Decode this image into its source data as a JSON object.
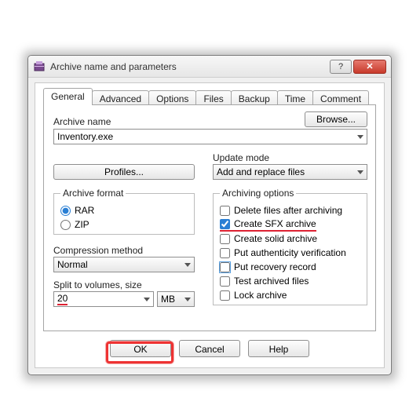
{
  "window": {
    "title": "Archive name and parameters"
  },
  "tabs": [
    "General",
    "Advanced",
    "Options",
    "Files",
    "Backup",
    "Time",
    "Comment"
  ],
  "archive_name": {
    "label": "Archive name",
    "value": "Inventory.exe",
    "browse": "Browse..."
  },
  "profiles_btn": "Profiles...",
  "update_mode": {
    "label": "Update mode",
    "value": "Add and replace files"
  },
  "archive_format": {
    "legend": "Archive format",
    "rar": "RAR",
    "zip": "ZIP"
  },
  "archiving_options": {
    "legend": "Archiving options",
    "items": [
      "Delete files after archiving",
      "Create SFX archive",
      "Create solid archive",
      "Put authenticity verification",
      "Put recovery record",
      "Test archived files",
      "Lock archive"
    ]
  },
  "compression": {
    "label": "Compression method",
    "value": "Normal"
  },
  "split": {
    "label": "Split to volumes, size",
    "value": "20",
    "unit": "MB"
  },
  "buttons": {
    "ok": "OK",
    "cancel": "Cancel",
    "help": "Help"
  }
}
